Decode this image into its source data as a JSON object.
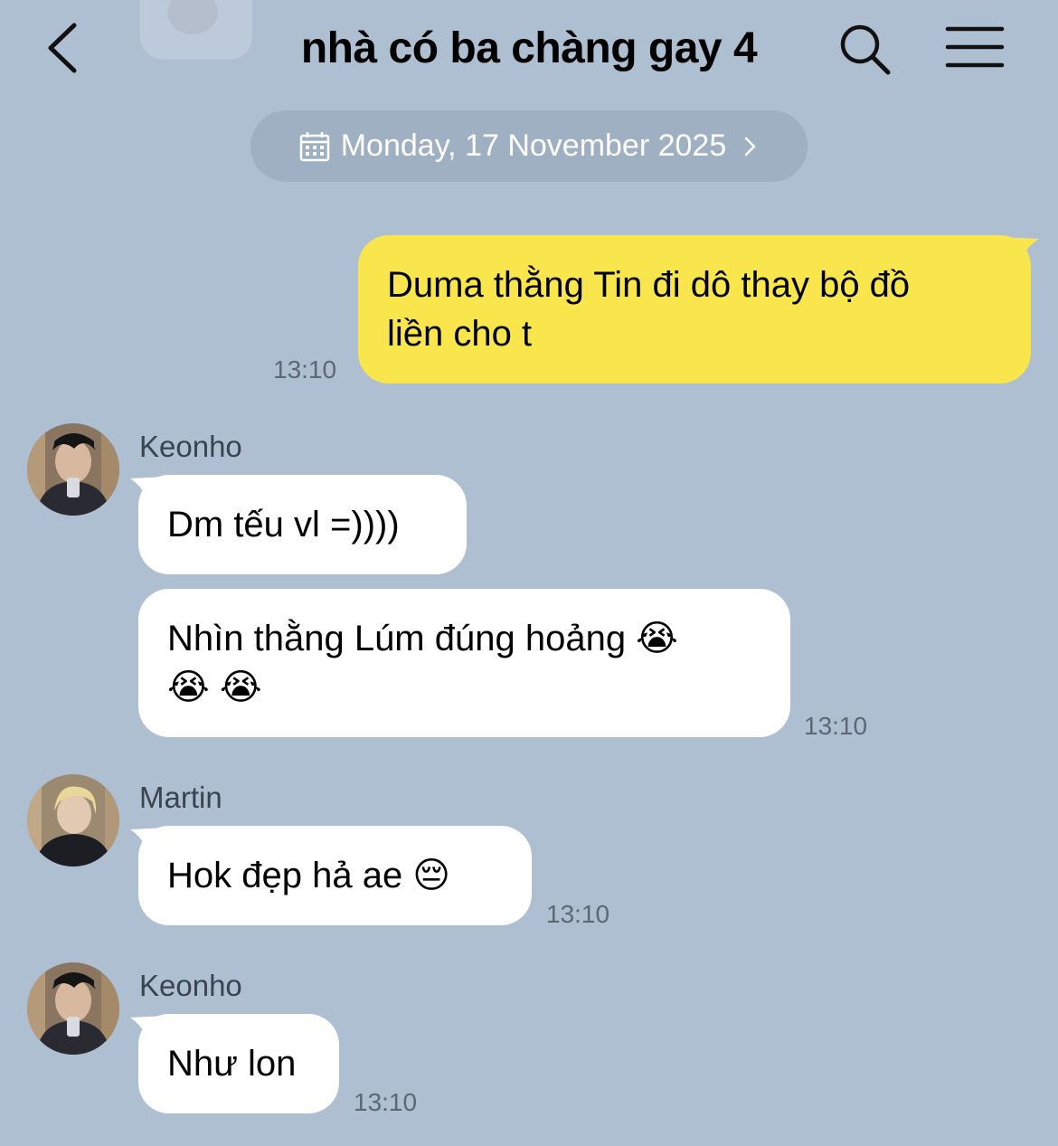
{
  "header": {
    "title": "nhà có ba chàng gay 4",
    "back_icon": "chevron-left-icon",
    "search_icon": "search-icon",
    "menu_icon": "hamburger-menu-icon"
  },
  "date_bar": {
    "label": "Monday, 17 November 2025",
    "icon": "calendar-icon"
  },
  "messages": [
    {
      "sender": "",
      "outgoing": true,
      "lines": [
        "Duma thằng Tin đi dô thay bộ đồ",
        "liền cho t"
      ],
      "time": "13:10"
    },
    {
      "sender": "Keonho",
      "outgoing": false,
      "lines": [
        "Dm tếu vl =))))"
      ],
      "time": ""
    },
    {
      "sender": "",
      "outgoing": false,
      "lines": [
        "Nhìn thằng Lúm đúng hoảng 😭",
        "😭 😭"
      ],
      "time": "13:10"
    },
    {
      "sender": "Martin",
      "outgoing": false,
      "lines": [
        "Hok đẹp hả ae 😔"
      ],
      "time": "13:10"
    },
    {
      "sender": "Keonho",
      "outgoing": false,
      "lines": [
        "Như lon"
      ],
      "time": "13:10"
    }
  ],
  "colors": {
    "background": "#aebfd1",
    "outgoing_bubble": "#f9e64c",
    "incoming_bubble": "#ffffff",
    "date_pill": "#9fb0c2"
  }
}
